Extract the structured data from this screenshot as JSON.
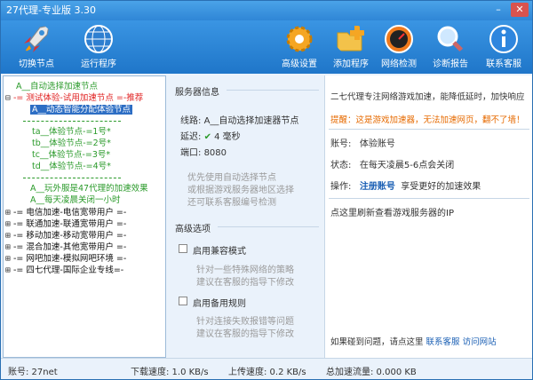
{
  "window": {
    "title": "27代理-专业版 3.30",
    "minimize": "–",
    "close": "✕"
  },
  "toolbar": {
    "switch_node": "切换节点",
    "run_program": "运行程序",
    "advanced": "高级设置",
    "add_program": "添加程序",
    "net_check": "网络检测",
    "diagnose": "诊断报告",
    "support": "联系客服"
  },
  "tree": {
    "auto_select": "A__自动选择加速节点",
    "trial": "-= 测试体验-试用加速节点 =-推荐",
    "dynamic": "A__动态智能分配体验节点",
    "ta": "ta__体验节点-=1号*",
    "tb": "tb__体验节点-=2号*",
    "tc": "tc__体验节点-=3号*",
    "td": "td__体验节点-=4号*",
    "play": "A__玩外服是47代理的加速效果",
    "daily": "A__每天凌晨关闭一小时",
    "telecom": "-= 电信加速-电信宽带用户 =-",
    "unicom": "-= 联通加速-联通宽带用户 =-",
    "mobile": "-= 移动加速-移动宽带用户 =-",
    "mixed": "-= 混合加速-其他宽带用户 =-",
    "netbar": "-= 网吧加速-模拟网吧环境 =-",
    "intl": "-= 四七代理-国际企业专线=-"
  },
  "server": {
    "heading": "服务器信息",
    "line_label": "线路:",
    "line_value": "A__自动选择加速器节点",
    "delay_label": "延迟:",
    "delay_value": "4 毫秒",
    "port_label": "端口:",
    "port_value": "8080",
    "hint1": "优先使用自动选择节点",
    "hint2": "或根据游戏服务器地区选择",
    "hint3": "还可联系客服编号检测"
  },
  "advanced_opts": {
    "heading": "高级选项",
    "compat": "启用兼容模式",
    "compat_hint1": "针对一些特殊网络的策略",
    "compat_hint2": "建议在客服的指导下修改",
    "backup": "启用备用规则",
    "backup_hint1": "针对连接失败报错等问题",
    "backup_hint2": "建议在客服的指导下修改"
  },
  "info": {
    "intro": "二七代理专注网络游戏加速，能降低延时，加快响应",
    "warning": "提醒：这是游戏加速器，无法加速网页，翻不了墙！",
    "account_label": "账号:",
    "account_value": "体验账号",
    "status_label": "状态:",
    "status_value": "在每天凌晨5-6点会关闭",
    "op_label": "操作:",
    "op_link": "注册账号",
    "op_text": "享受更好的加速效果",
    "refresh": "点这里刷新查看游戏服务器的IP",
    "problem": "如果碰到问题，请点这里",
    "contact": "联系客服",
    "site": "访问网站"
  },
  "statusbar": {
    "account": "账号: 27net",
    "download": "下载速度: 1.0 KB/s",
    "upload": "上传速度: 0.2 KB/s",
    "total": "总加速流量: 0.000 KB"
  }
}
